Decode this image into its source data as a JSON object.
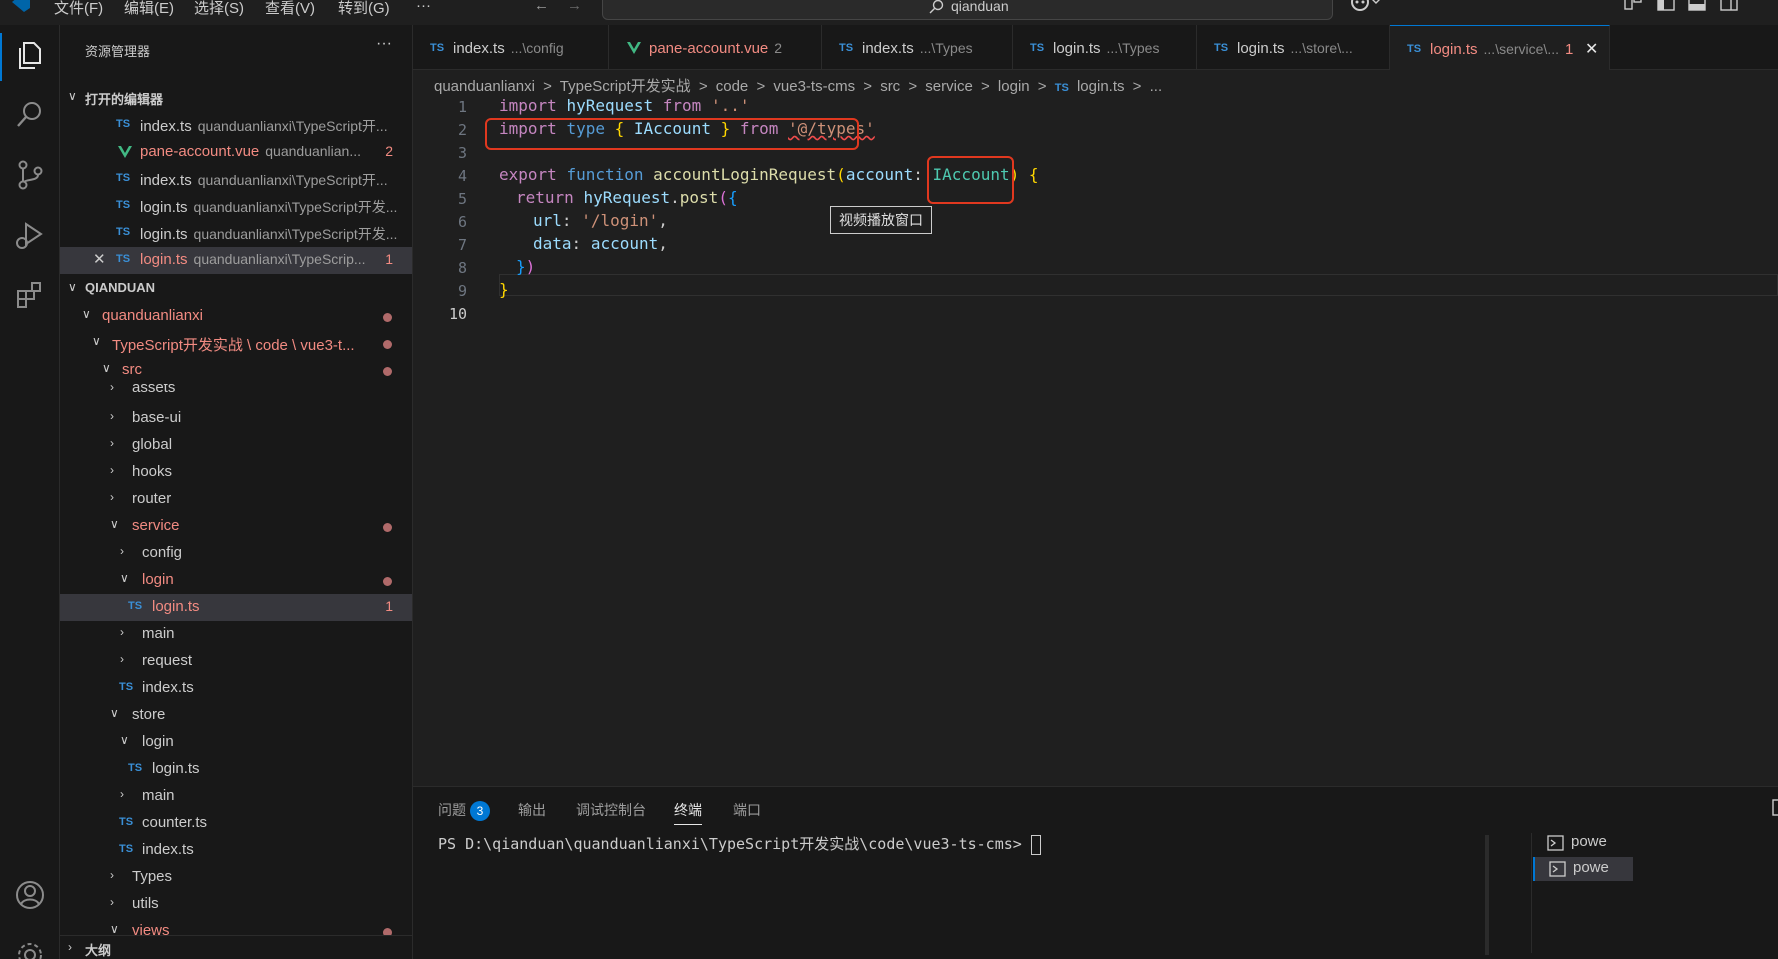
{
  "menu": [
    "文件(F)",
    "编辑(E)",
    "选择(S)",
    "查看(V)",
    "转到(G)",
    "···"
  ],
  "search": {
    "text": "qianduan"
  },
  "sidebar": {
    "title": "资源管理器",
    "more": "···",
    "open_editors_header": "打开的编辑器",
    "open_editors": [
      {
        "icon": "TS",
        "name": "index.ts",
        "desc": "quanduanlianxi\\TypeScript开..."
      },
      {
        "icon": "V",
        "name": "pane-account.vue",
        "desc": "quanduanlian...",
        "badge": "2"
      },
      {
        "icon": "TS",
        "name": "index.ts",
        "desc": "quanduanlianxi\\TypeScript开..."
      },
      {
        "icon": "TS",
        "name": "login.ts",
        "desc": "quanduanlianxi\\TypeScript开发..."
      },
      {
        "icon": "TS",
        "name": "login.ts",
        "desc": "quanduanlianxi\\TypeScript开发..."
      },
      {
        "icon": "TS",
        "name": "login.ts",
        "desc": "quanduanlianxi\\TypeScrip...",
        "badge": "1"
      }
    ],
    "workspace_header": "QIANDUAN",
    "tree": [
      {
        "label": "quanduanlianxi"
      },
      {
        "label": "TypeScript开发实战 \\ code \\ vue3-t..."
      },
      {
        "label": "src"
      },
      {
        "label": "assets"
      },
      {
        "label": "base-ui"
      },
      {
        "label": "global"
      },
      {
        "label": "hooks"
      },
      {
        "label": "router"
      },
      {
        "label": "service"
      },
      {
        "label": "config"
      },
      {
        "label": "login"
      },
      {
        "label": "login.ts",
        "badge": "1"
      },
      {
        "label": "main"
      },
      {
        "label": "request"
      },
      {
        "label": "index.ts"
      },
      {
        "label": "store"
      },
      {
        "label": "login"
      },
      {
        "label": "login.ts"
      },
      {
        "label": "main"
      },
      {
        "label": "counter.ts"
      },
      {
        "label": "index.ts"
      },
      {
        "label": "Types"
      },
      {
        "label": "utils"
      },
      {
        "label": "views"
      }
    ],
    "outline_header": "大纲"
  },
  "tabs": [
    {
      "icon": "TS",
      "name": "index.ts",
      "sub": "...\\config"
    },
    {
      "icon": "V",
      "name": "pane-account.vue",
      "sub": "2"
    },
    {
      "icon": "TS",
      "name": "index.ts",
      "sub": "...\\Types"
    },
    {
      "icon": "TS",
      "name": "login.ts",
      "sub": "...\\Types"
    },
    {
      "icon": "TS",
      "name": "login.ts",
      "sub": "...\\store\\..."
    },
    {
      "icon": "TS",
      "name": "login.ts",
      "sub": "...\\service\\...",
      "badge": "1",
      "close": "✕"
    }
  ],
  "breadcrumb": [
    "quanduanlianxi",
    ">",
    "TypeScript开发实战",
    ">",
    "code",
    ">",
    "vue3-ts-cms",
    ">",
    "src",
    ">",
    "service",
    ">",
    "login",
    ">",
    "TS",
    "login.ts",
    ">",
    "..."
  ],
  "code": {
    "line_numbers": [
      "1",
      "2",
      "3",
      "4",
      "5",
      "6",
      "7",
      "8",
      "9",
      "10"
    ],
    "l1": {
      "a": "import",
      "b": "hyRequest",
      "c": "from",
      "d": "'..'"
    },
    "l2": {
      "a": "import",
      "b": "type",
      "c": "{",
      "d": "IAccount",
      "e": "}",
      "f": "from",
      "g": "'@/types'"
    },
    "l4": {
      "a": "export",
      "b": "function",
      "c": "accountLoginRequest",
      "d": "(",
      "e": "account",
      "f": ":",
      "g": "IAccount",
      "h": ")",
      "i": "{"
    },
    "l5": {
      "a": "return",
      "b": "hyRequest",
      "c": ".",
      "d": "post",
      "e": "(",
      "f": "{"
    },
    "l6": {
      "a": "url",
      "b": ":",
      "c": "'/login'",
      "d": ","
    },
    "l7": {
      "a": "data",
      "b": ":",
      "c": "account",
      "d": ","
    },
    "l8": {
      "a": "}",
      "b": ")"
    },
    "l9": {
      "a": "}"
    }
  },
  "tooltip": "视频播放窗口",
  "panel": {
    "tabs": [
      "问题",
      "输出",
      "调试控制台",
      "终端",
      "端口"
    ],
    "problems_count": "3",
    "terminal_prompt": "PS D:\\qianduan\\quanduanlianxi\\TypeScript开发实战\\code\\vue3-ts-cms> ",
    "terminals": [
      "powe",
      "powe"
    ]
  }
}
